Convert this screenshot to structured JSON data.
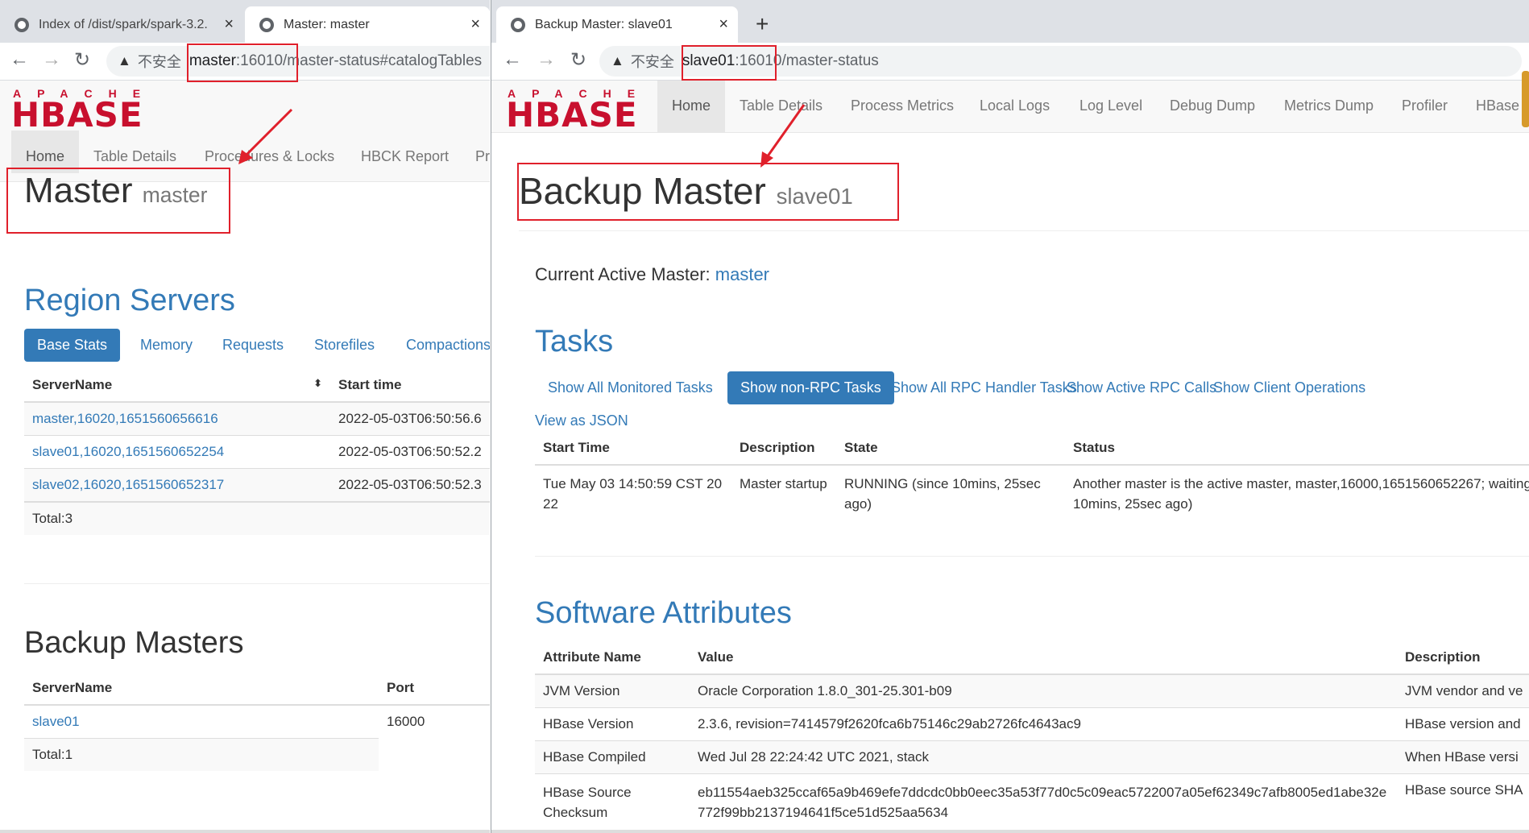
{
  "left": {
    "tabs": [
      {
        "title": "Index of /dist/spark/spark-3.2.",
        "close": "×"
      },
      {
        "title": "Master: master",
        "close": "×"
      }
    ],
    "address": {
      "insecure": "不安全",
      "host": "master",
      "rest": ":16010/master-status#catalogTables"
    },
    "logo": {
      "top": "APACHE",
      "bottom": "HBASE"
    },
    "nav": [
      "Home",
      "Table Details",
      "Procedures & Locks",
      "HBCK Report",
      "Pr"
    ],
    "heading": {
      "title": "Master",
      "sub": "master"
    },
    "region_servers": {
      "title": "Region Servers",
      "tabs": [
        "Base Stats",
        "Memory",
        "Requests",
        "Storefiles",
        "Compactions"
      ],
      "headers": [
        "ServerName",
        "Start time"
      ],
      "sort_icon": "⬍",
      "rows": [
        {
          "name": "master,16020,1651560656616",
          "start": "2022-05-03T06:50:56.6"
        },
        {
          "name": "slave01,16020,1651560652254",
          "start": "2022-05-03T06:50:52.2"
        },
        {
          "name": "slave02,16020,1651560652317",
          "start": "2022-05-03T06:50:52.3"
        }
      ],
      "total": "Total:3"
    },
    "backup_masters": {
      "title": "Backup Masters",
      "headers": [
        "ServerName",
        "Port"
      ],
      "rows": [
        {
          "name": "slave01",
          "port": "16000"
        }
      ],
      "total": "Total:1"
    }
  },
  "right": {
    "tab": {
      "title": "Backup Master: slave01",
      "close": "×",
      "new_tab": "+"
    },
    "address": {
      "insecure": "不安全",
      "host": "slave01",
      "rest": ":16010/master-status"
    },
    "logo": {
      "top": "APACHE",
      "bottom": "HBASE"
    },
    "nav": [
      "Home",
      "Table Details",
      "Process Metrics",
      "Local Logs",
      "Log Level",
      "Debug Dump",
      "Metrics Dump",
      "Profiler",
      "HBase"
    ],
    "heading": {
      "title": "Backup Master",
      "sub": "slave01"
    },
    "active_master": {
      "label": "Current Active Master:",
      "value": "master"
    },
    "tasks": {
      "title": "Tasks",
      "tabs": [
        "Show All Monitored Tasks",
        "Show non-RPC Tasks",
        "Show All RPC Handler Tasks",
        "Show Active RPC Calls",
        "Show Client Operations"
      ],
      "json_link": "View as JSON",
      "headers": [
        "Start Time",
        "Description",
        "State",
        "Status"
      ],
      "rows": [
        {
          "start": "Tue May 03 14:50:59 CST 2022",
          "desc": "Master startup",
          "state": "RUNNING (since 10mins, 25sec ago)",
          "status": "Another master is the active master, master,16000,1651560652267; waiting (since 10mins, 25sec ago)"
        }
      ]
    },
    "software": {
      "title": "Software Attributes",
      "headers": [
        "Attribute Name",
        "Value",
        "Description"
      ],
      "rows": [
        {
          "name": "JVM Version",
          "value": "Oracle Corporation 1.8.0_301-25.301-b09",
          "desc": "JVM vendor and ve"
        },
        {
          "name": "HBase Version",
          "value": "2.3.6, revision=7414579f2620fca6b75146c29ab2726fc4643ac9",
          "desc": "HBase version and"
        },
        {
          "name": "HBase Compiled",
          "value": "Wed Jul 28 22:24:42 UTC 2021, stack",
          "desc": "When HBase versi"
        },
        {
          "name": "HBase Source Checksum",
          "value": "eb11554aeb325ccaf65a9b469efe7ddcdc0bb0eec35a53f77d0c5c09eac5722007a05ef62349c7afb8005ed1abe32e772f99bb2137194641f5ce51d525aa5634",
          "desc": "HBase source SHA"
        }
      ]
    }
  },
  "colors": {
    "link": "#337ab7",
    "annotation": "#e0202b",
    "active_pill": "#337ab7"
  }
}
